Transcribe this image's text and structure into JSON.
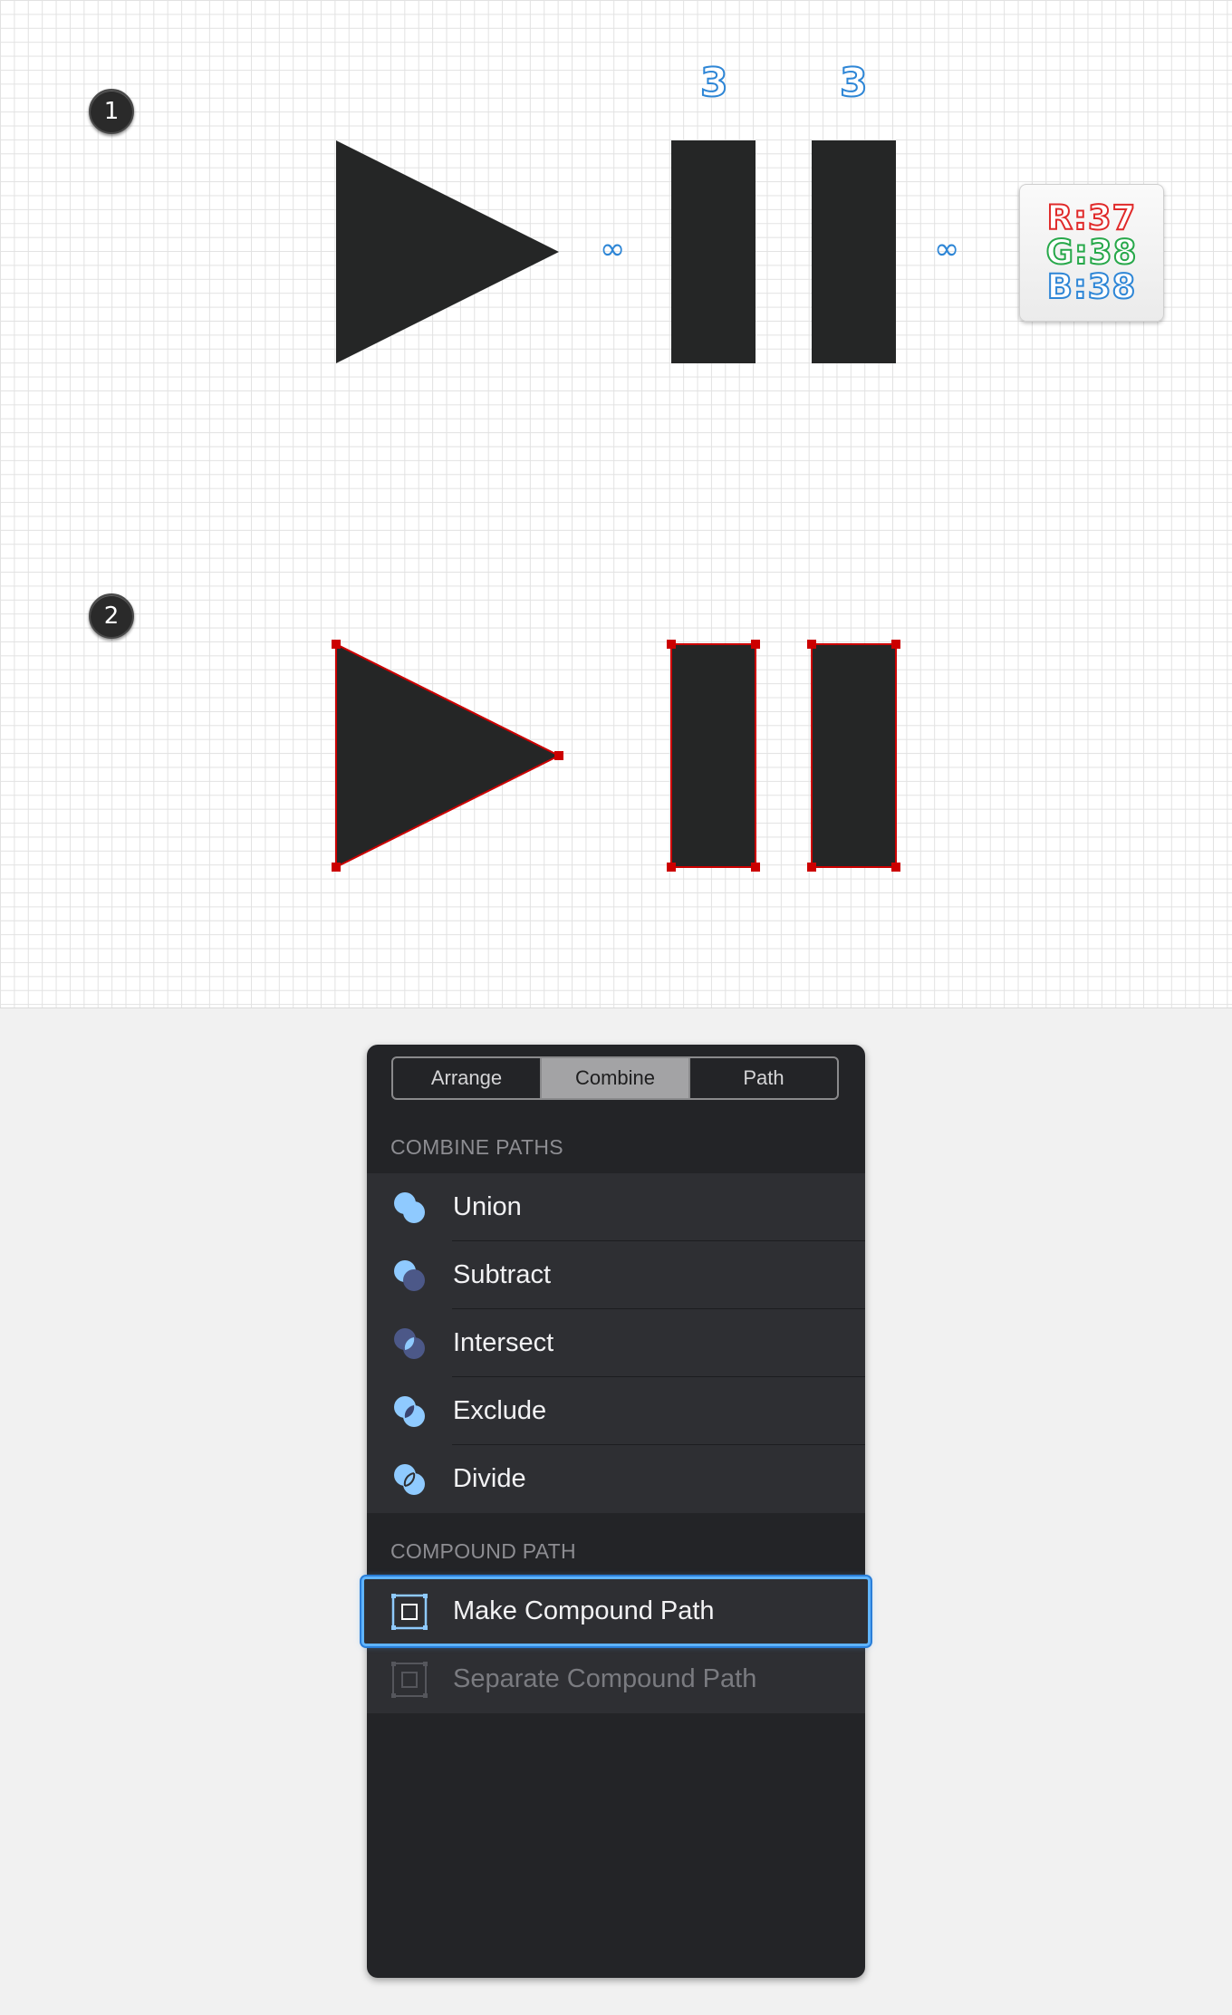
{
  "canvas": {
    "step1": "1",
    "step2": "2",
    "dimension_labels": [
      "3",
      "3"
    ],
    "link_icon_glyph": "∞",
    "color_readout": {
      "r": "R:37",
      "g": "G:38",
      "b": "B:38"
    },
    "shape_fill": "#252626",
    "selection_color": "#cc0000"
  },
  "panel": {
    "tabs": [
      {
        "label": "Arrange",
        "active": false
      },
      {
        "label": "Combine",
        "active": true
      },
      {
        "label": "Path",
        "active": false
      }
    ],
    "combine_header": "COMBINE PATHS",
    "combine_items": [
      {
        "label": "Union",
        "icon": "union-icon"
      },
      {
        "label": "Subtract",
        "icon": "subtract-icon"
      },
      {
        "label": "Intersect",
        "icon": "intersect-icon"
      },
      {
        "label": "Exclude",
        "icon": "exclude-icon"
      },
      {
        "label": "Divide",
        "icon": "divide-icon"
      }
    ],
    "compound_header": "COMPOUND PATH",
    "compound_items": [
      {
        "label": "Make Compound Path",
        "icon": "make-compound-path-icon",
        "selected": true,
        "enabled": true
      },
      {
        "label": "Separate Compound Path",
        "icon": "separate-compound-path-icon",
        "selected": false,
        "enabled": false
      }
    ]
  }
}
